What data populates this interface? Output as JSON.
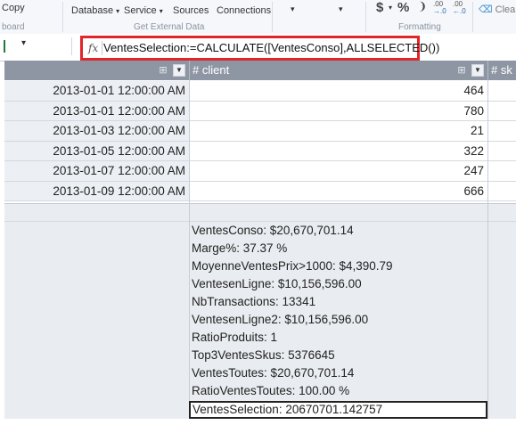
{
  "ribbon": {
    "clipboard_label": "Copy",
    "clipboard_group": "board",
    "database_label": "Database",
    "service_label": "Service",
    "sources_label": "Sources",
    "connections_label": "Connections",
    "get_external_group": "Get External Data",
    "dd1_caret": "▾",
    "dd2_caret": "▾",
    "currency": "$",
    "percent": "%",
    "comma": "❩",
    "dec_inc_top": ".00",
    "dec_inc_bottom": "→.0",
    "dec_dec_top": ".00",
    "dec_dec_bottom": "←.0",
    "formatting_group": "Formatting",
    "clear_label": "Clea"
  },
  "formula_bar": {
    "fx": "fx",
    "formula": "VentesSelection:=CALCULATE([VentesConso],ALLSELECTED())"
  },
  "columns": [
    {
      "label": ""
    },
    {
      "label": "# client"
    },
    {
      "label": "# sk"
    }
  ],
  "rows": [
    {
      "date": "2013-01-01 12:00:00 AM",
      "client": "464"
    },
    {
      "date": "2013-01-01 12:00:00 AM",
      "client": "780"
    },
    {
      "date": "2013-01-03 12:00:00 AM",
      "client": "21"
    },
    {
      "date": "2013-01-05 12:00:00 AM",
      "client": "322"
    },
    {
      "date": "2013-01-07 12:00:00 AM",
      "client": "247"
    },
    {
      "date": "2013-01-09 12:00:00 AM",
      "client": "666"
    }
  ],
  "measures": [
    "VentesConso: $20,670,701.14",
    "Marge%: 37.37 %",
    "MoyenneVentesPrix>1000: $4,390.79",
    "VentesenLigne: $10,156,596.00",
    "NbTransactions: 13341",
    "VentesenLigne2: $10,156,596.00",
    "RatioProduits: 1",
    "Top3VentesSkus: 5376645",
    "VentesToutes: $20,670,701.14",
    "RatioVentesToutes: 100.00 %",
    "VentesSelection: 20670701.142757"
  ],
  "colors": {
    "header": "#8e96a4",
    "highlight": "#e0252b",
    "alt_row": "#eceff3"
  }
}
